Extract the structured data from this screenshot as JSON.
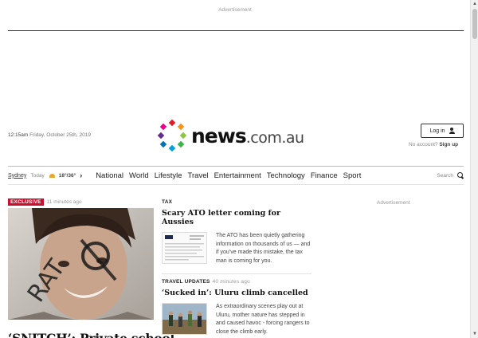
{
  "ads": {
    "top_label": "Advertisement",
    "side_label": "Advertisement"
  },
  "header": {
    "time": "12:15am",
    "date": "Friday, October 25th, 2019",
    "logo_news": "news",
    "logo_domain": ".com.au",
    "login_label": "Log in",
    "no_account_text": "No account?",
    "signup_label": "Sign up"
  },
  "weather": {
    "city": "Sydney",
    "day": "Today",
    "temps": "18°/36°",
    "icon": "sun-cloud-icon"
  },
  "nav": {
    "links": [
      "National",
      "World",
      "Lifestyle",
      "Travel",
      "Entertainment",
      "Technology",
      "Finance",
      "Sport"
    ],
    "search_label": "Search"
  },
  "lead_story": {
    "badge": "EXCLUSIVE",
    "time_ago": "11 minutes ago",
    "title": "‘SNITCH’: Private school",
    "image_overlay": "RAT"
  },
  "stories": [
    {
      "section": "TAX",
      "time_ago": "",
      "title": "Scary ATO letter coming for Aussies",
      "teaser": "The ATO has been quietly gathering information on thousands of us — and if you’ve made this mistake, the tax man is coming for you."
    },
    {
      "section": "TRAVEL UPDATES",
      "time_ago": "40 minutes ago",
      "title": "‘Sucked in’: Uluru climb cancelled",
      "teaser": "As extraordinary scenes play out at Uluru, mother nature has stepped in and caused havoc - forcing rangers to close the climb early."
    }
  ],
  "colors": {
    "accent": "#c8102e",
    "text": "#222222"
  }
}
